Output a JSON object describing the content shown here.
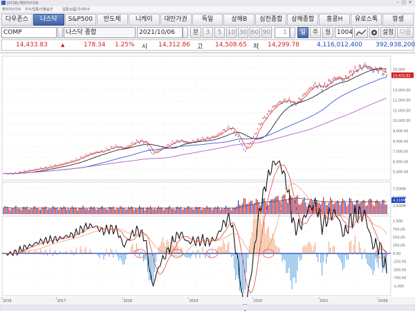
{
  "window": {
    "title": "[0726] 해외지수차트",
    "menu": [
      "해외지수차트",
      "지수/업종/선물옵션",
      "업종/상품/국내지수"
    ]
  },
  "tabs": [
    "다우존스",
    "나스닥",
    "S&P500",
    "반도체",
    "니케이",
    "대만가권",
    "독일",
    "상해B",
    "심천종합",
    "상해종합",
    "홍콩H",
    "유로스톡",
    "항셍"
  ],
  "active_tab": 1,
  "toolbar": {
    "symbol": "COMP",
    "name": "나스닥 종합",
    "date": "2021/10/06",
    "period_label": "분",
    "periods": [
      "3",
      "5",
      "10",
      "30",
      "60",
      "90"
    ],
    "count_value": "1",
    "day_label": "일",
    "week_label": "주",
    "month_label": "월",
    "bars_value": "1004",
    "settings_label": "설정",
    "next_label": "다음",
    "draw_icon": "trend-line-icon",
    "gear_icon": "gear-icon"
  },
  "quote": {
    "price": "14,433.83",
    "change": "178.34",
    "change_pct": "1.25%",
    "open_label": "시",
    "open": "14,312.86",
    "high_label": "고",
    "high": "14,508.65",
    "low_label": "저",
    "low": "14,299.78",
    "volume": "4,116,012,400",
    "amount": "392,938,200"
  },
  "colors": {
    "up": "#d42020",
    "down": "#1c43c4",
    "accent": "#3e62a8"
  },
  "chart_data": {
    "type": "line",
    "price": {
      "series": [
        {
          "name": "",
          "values": [
            4840,
            4820,
            4900,
            5050,
            5150,
            5300,
            5400,
            5550,
            5700,
            5900,
            6100,
            6400,
            6700,
            6900,
            7000,
            7300,
            7500,
            7250,
            7700,
            8000,
            7950,
            6700,
            7200,
            7500,
            7900,
            8050,
            7800,
            8000,
            8200,
            8300,
            8500,
            9000,
            9400,
            8500,
            7000,
            8000,
            9500,
            10500,
            11300,
            11800,
            12000,
            11600,
            12200,
            13000,
            13500,
            13200,
            13800,
            14200,
            14000,
            14700,
            15100,
            15400,
            14900,
            15000,
            14433
          ]
        }
      ],
      "ylim": [
        4200,
        16300
      ],
      "y_ticks": [
        "15,000",
        "14,433.83",
        "13,000.00",
        "12,000.00",
        "11,000.00",
        "10,000.00",
        "9,000.00",
        "8,000.00",
        "7,000.00",
        "6,000.00",
        "5,000.00"
      ]
    },
    "volume": {
      "ylim": [
        0,
        9500
      ],
      "y_ticks": [
        "7,500M",
        "5,000M",
        "4,116M",
        "2,500M"
      ]
    },
    "oscillator": {
      "ylim": [
        -1300,
        1150
      ],
      "y_ticks": [
        "1,000",
        "750.00",
        "500.00",
        "250.00",
        "0.00",
        "-250.00",
        "-500.00",
        "-750.00",
        "-1,000"
      ]
    },
    "x_labels": [
      "2016",
      "2017",
      "2018",
      "2019",
      "2020",
      "2021",
      "10/06"
    ]
  }
}
